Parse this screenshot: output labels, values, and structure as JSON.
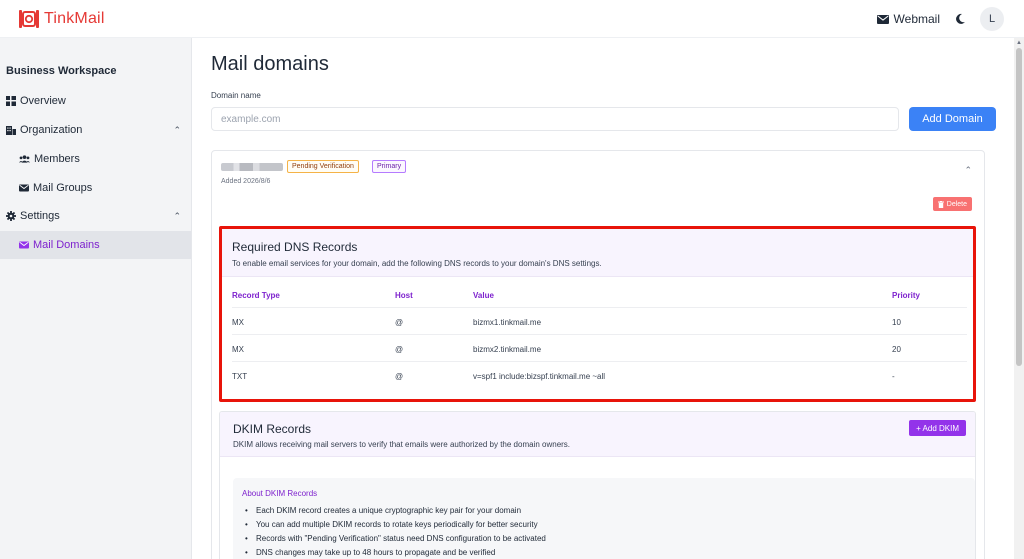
{
  "app": {
    "name": "TinkMail"
  },
  "header": {
    "webmail_label": "Webmail",
    "avatar_initial": "L"
  },
  "sidebar": {
    "workspace_title": "Business Workspace",
    "items": [
      {
        "label": "Overview",
        "icon": "grid-icon"
      },
      {
        "label": "Organization",
        "icon": "building-icon",
        "expanded": true
      },
      {
        "label": "Members",
        "icon": "users-icon"
      },
      {
        "label": "Mail Groups",
        "icon": "mail-group-icon"
      },
      {
        "label": "Settings",
        "icon": "gear-icon",
        "expanded": true
      },
      {
        "label": "Mail Domains",
        "icon": "mail-domains-icon",
        "active": true
      }
    ]
  },
  "main": {
    "title": "Mail domains",
    "domain_field": {
      "label": "Domain name",
      "placeholder": "example.com",
      "value": ""
    },
    "add_domain_label": "Add Domain",
    "domain": {
      "status_badge": "Pending Verification",
      "primary_badge": "Primary",
      "added": "Added 2026/8/6",
      "delete_label": "Delete"
    },
    "dns": {
      "title": "Required DNS Records",
      "description": "To enable email services for your domain, add the following DNS records to your domain's DNS settings.",
      "columns": [
        "Record Type",
        "Host",
        "Value",
        "Priority"
      ],
      "rows": [
        [
          "MX",
          "@",
          "bizmx1.tinkmail.me",
          "10"
        ],
        [
          "MX",
          "@",
          "bizmx2.tinkmail.me",
          "20"
        ],
        [
          "TXT",
          "@",
          "v=spf1 include:bizspf.tinkmail.me ~all",
          "-"
        ]
      ]
    },
    "dkim": {
      "title": "DKIM Records",
      "description": "DKIM allows receiving mail servers to verify that emails were authorized by the domain owners.",
      "add_label": "+ Add DKIM",
      "about_title": "About DKIM Records",
      "about_items": [
        "Each DKIM record creates a unique cryptographic key pair for your domain",
        "You can add multiple DKIM records to rotate keys periodically for better security",
        "Records with \"Pending Verification\" status need DNS configuration to be activated",
        "DNS changes may take up to 48 hours to propagate and be verified"
      ]
    }
  },
  "colors": {
    "brand": "#e53935",
    "accent": "#7e22ce",
    "primary_button": "#3b82f6",
    "delete": "#f87171",
    "highlight_border": "#e8140a"
  }
}
